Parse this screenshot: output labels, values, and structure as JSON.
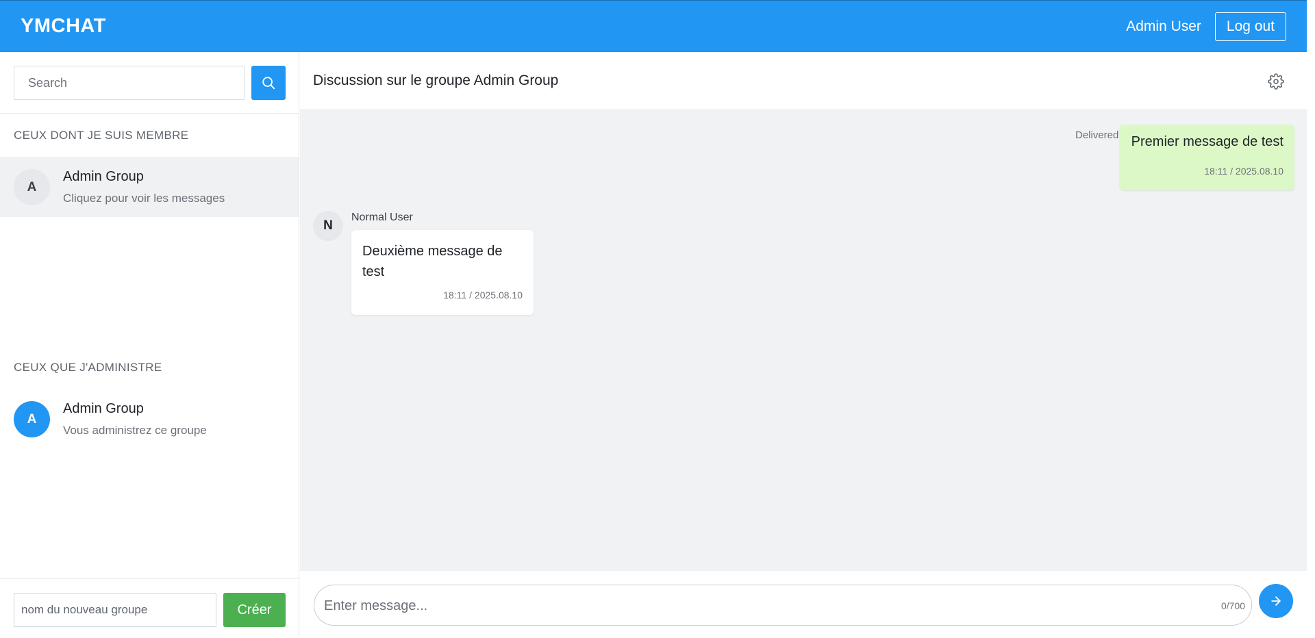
{
  "header": {
    "logo": "YMCHAT",
    "user_name": "Admin User",
    "logout_label": "Log out"
  },
  "sidebar": {
    "search_placeholder": "Search",
    "member_section_title": "CEUX DONT JE SUIS MEMBRE",
    "member_groups": [
      {
        "initial": "A",
        "name": "Admin Group",
        "subtitle": "Cliquez pour voir les messages"
      }
    ],
    "admin_section_title": "CEUX QUE J'ADMINISTRE",
    "admin_groups": [
      {
        "initial": "A",
        "name": "Admin Group",
        "subtitle": "Vous administrez ce groupe"
      }
    ],
    "new_group_placeholder": "nom du nouveau groupe",
    "create_label": "Créer"
  },
  "chat": {
    "title": "Discussion sur le groupe Admin Group",
    "messages": [
      {
        "direction": "outgoing",
        "text": "Premier message de test",
        "time": "18:11 / 2025.08.10",
        "status": "Delivered"
      },
      {
        "direction": "incoming",
        "sender": "Normal User",
        "sender_initial": "N",
        "text": "Deuxième message de test",
        "time": "18:11 / 2025.08.10"
      }
    ],
    "input_placeholder": "Enter message...",
    "char_counter": "0/700"
  },
  "colors": {
    "primary": "#2196f3",
    "create_button": "#4caf50",
    "outgoing_bubble": "#dcf8c6",
    "chat_background": "#f0f2f4"
  },
  "icons": {
    "search": "search-icon",
    "settings": "gear-icon",
    "send": "arrow-right-icon"
  }
}
